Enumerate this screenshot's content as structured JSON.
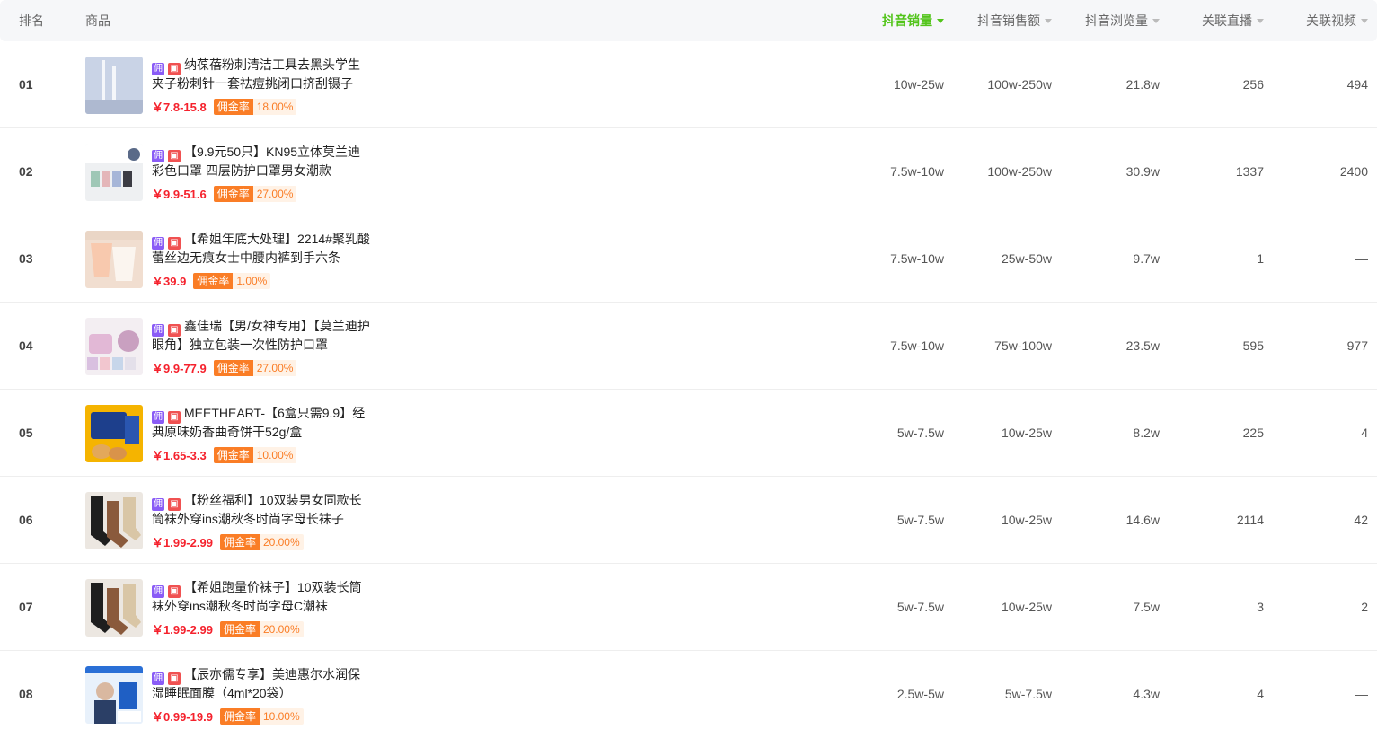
{
  "header": {
    "rank": "排名",
    "product": "商品",
    "sales": "抖音销量",
    "amount": "抖音销售额",
    "views": "抖音浏览量",
    "live": "关联直播",
    "video": "关联视频"
  },
  "badges": {
    "yong": "佣",
    "shop": "▣"
  },
  "commission_label": "佣金率",
  "rows": [
    {
      "rank": "01",
      "title": "纳葆蓓粉刺清洁工具去黑头学生夹子粉刺针一套祛痘挑闭口挤刮镊子",
      "price": "￥7.8-15.8",
      "commission": "18.00%",
      "sales": "10w-25w",
      "amount": "100w-250w",
      "views": "21.8w",
      "live": "256",
      "video": "494"
    },
    {
      "rank": "02",
      "title": "【9.9元50只】KN95立体莫兰迪彩色口罩 四层防护口罩男女潮款",
      "price": "￥9.9-51.6",
      "commission": "27.00%",
      "sales": "7.5w-10w",
      "amount": "100w-250w",
      "views": "30.9w",
      "live": "1337",
      "video": "2400"
    },
    {
      "rank": "03",
      "title": "【希姐年底大处理】2214#聚乳酸蕾丝边无痕女士中腰内裤到手六条",
      "price": "￥39.9",
      "commission": "1.00%",
      "sales": "7.5w-10w",
      "amount": "25w-50w",
      "views": "9.7w",
      "live": "1",
      "video": "—"
    },
    {
      "rank": "04",
      "title": "鑫佳瑞【男/女神专用】【莫兰迪护眼角】独立包装一次性防护口罩",
      "price": "￥9.9-77.9",
      "commission": "27.00%",
      "sales": "7.5w-10w",
      "amount": "75w-100w",
      "views": "23.5w",
      "live": "595",
      "video": "977"
    },
    {
      "rank": "05",
      "title": "MEETHEART-【6盒只需9.9】经典原味奶香曲奇饼干52g/盒",
      "price": "￥1.65-3.3",
      "commission": "10.00%",
      "sales": "5w-7.5w",
      "amount": "10w-25w",
      "views": "8.2w",
      "live": "225",
      "video": "4"
    },
    {
      "rank": "06",
      "title": "【粉丝福利】10双装男女同款长筒袜外穿ins潮秋冬时尚字母长袜子",
      "price": "￥1.99-2.99",
      "commission": "20.00%",
      "sales": "5w-7.5w",
      "amount": "10w-25w",
      "views": "14.6w",
      "live": "2114",
      "video": "42"
    },
    {
      "rank": "07",
      "title": "【希姐跑量价袜子】10双装长筒袜外穿ins潮秋冬时尚字母C潮袜",
      "price": "￥1.99-2.99",
      "commission": "20.00%",
      "sales": "5w-7.5w",
      "amount": "10w-25w",
      "views": "7.5w",
      "live": "3",
      "video": "2"
    },
    {
      "rank": "08",
      "title": "【辰亦儒专享】美迪惠尔水润保湿睡眠面膜（4ml*20袋）",
      "price": "￥0.99-19.9",
      "commission": "10.00%",
      "sales": "2.5w-5w",
      "amount": "5w-7.5w",
      "views": "4.3w",
      "live": "4",
      "video": "—"
    }
  ]
}
